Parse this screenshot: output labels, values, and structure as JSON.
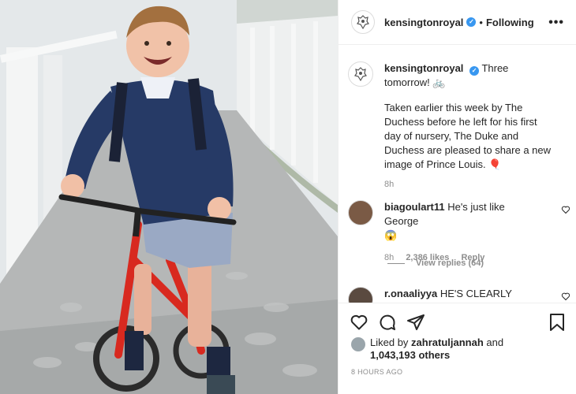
{
  "header": {
    "username": "kensingtonroyal",
    "separator": "•",
    "follow_label": "Following",
    "more_label": "•••"
  },
  "caption": {
    "username": "kensingtonroyal",
    "line1": "Three tomorrow!",
    "emoji": "🚲",
    "paragraph": "Taken earlier this week by The Duchess before he left for his first day of nursery, The Duke and Duchess are pleased to share a new image of Prince Louis.",
    "paragraph_emoji": "🎈",
    "time": "8h"
  },
  "comments": [
    {
      "username": "biagoulart11",
      "text": "He's just like George",
      "emoji": "😱",
      "time": "8h",
      "likes": "2,386 likes",
      "reply_label": "Reply"
    },
    {
      "username": "r.onaaliyya",
      "text": "HE'S CLEARLY"
    }
  ],
  "view_replies": "View replies (64)",
  "likes": {
    "prefix": "Liked by",
    "user": "zahratuljannah",
    "and": "and",
    "count": "1,043,193 others"
  },
  "timestamp": "8 HOURS AGO",
  "colors": {
    "verified": "#3897f0",
    "muted": "#8e8e8e",
    "border": "#efefef"
  },
  "icons": [
    "crest-icon",
    "verified-icon",
    "heart-icon",
    "comment-icon",
    "share-icon",
    "bookmark-icon"
  ]
}
